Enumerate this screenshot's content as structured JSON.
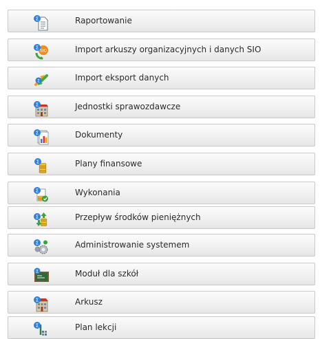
{
  "menu": {
    "items": [
      {
        "label": "Raportowanie",
        "icon": "report-document-icon"
      },
      {
        "label": "Import arkuszy organizacyjnych i danych SIO",
        "icon": "sio-import-icon"
      },
      {
        "label": "Import eksport danych",
        "icon": "import-export-arrows-icon"
      },
      {
        "label": "Jednostki sprawozdawcze",
        "icon": "building-units-icon"
      },
      {
        "label": "Dokumenty",
        "icon": "documents-chart-icon"
      },
      {
        "label": "Plany finansowe",
        "icon": "coin-stack-icon"
      },
      {
        "label": "Wykonania",
        "icon": "execution-check-icon"
      },
      {
        "label": "Przepływ środków pieniężnych",
        "icon": "cash-flow-icon"
      },
      {
        "label": "Administrowanie systemem",
        "icon": "gears-settings-icon"
      },
      {
        "label": "Moduł dla szkół",
        "icon": "school-board-icon"
      },
      {
        "label": "Arkusz",
        "icon": "sheet-building-icon"
      },
      {
        "label": "Plan lekcji",
        "icon": "lesson-plan-icon"
      }
    ]
  },
  "colors": {
    "row_border": "#c9c9c9",
    "text": "#2b2b2b",
    "badge_blue": "#2f7fd8"
  }
}
